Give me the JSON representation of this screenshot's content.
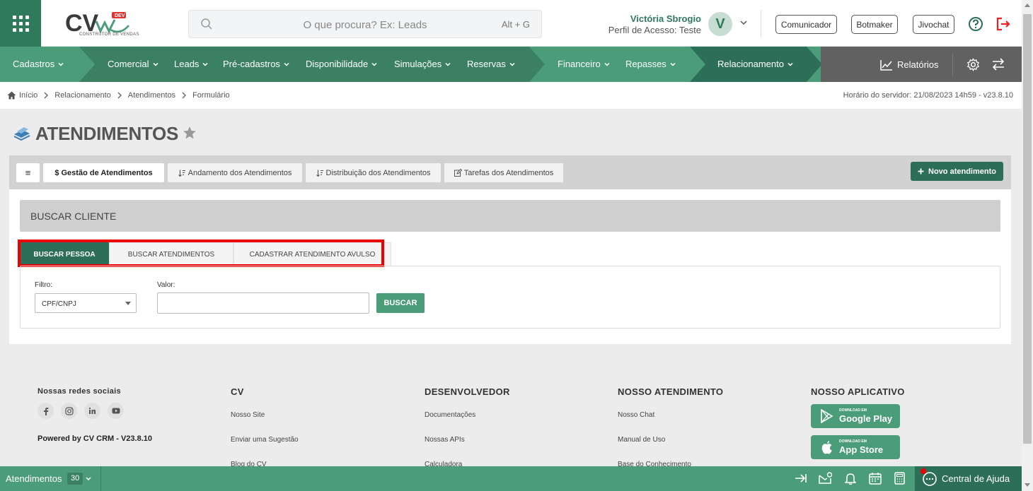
{
  "header": {
    "logo_text": "CV",
    "logo_badge": "DEV",
    "logo_sub": "CONSTRUTOR DE VENDAS",
    "search_placeholder": "O que procura? Ex: Leads",
    "search_shortcut": "Alt + G",
    "user_name": "Victória Sbrogio",
    "user_profile": "Perfil de Acesso: Teste",
    "avatar_letter": "V",
    "buttons": {
      "comunicador": "Comunicador",
      "botmaker": "Botmaker",
      "jivochat": "Jivochat"
    }
  },
  "nav": {
    "items": [
      "Cadastros",
      "Comercial",
      "Leads",
      "Pré-cadastros",
      "Disponibilidade",
      "Simulações",
      "Reservas",
      "Financeiro",
      "Repasses",
      "Relacionamento"
    ],
    "reports": "Relatórios"
  },
  "breadcrumb": {
    "items": [
      "Início",
      "Relacionamento",
      "Atendimentos",
      "Formulário"
    ],
    "server_time": "Horário do servidor: 21/08/2023 14h59 - v23.8.10"
  },
  "page": {
    "title": "ATENDIMENTOS"
  },
  "tabs": {
    "menu_glyph": "≡",
    "items": [
      "$ Gestão de Atendimentos",
      "Andamento dos Atendimentos",
      "Distribuição dos Atendimentos",
      "Tarefas dos Atendimentos"
    ],
    "new_button": "Novo atendimento"
  },
  "search_client": {
    "header": "BUSCAR CLIENTE",
    "subtabs": [
      "BUSCAR PESSOA",
      "BUSCAR ATENDIMENTOS",
      "CADASTRAR ATENDIMENTO AVULSO"
    ],
    "filter_label": "Filtro:",
    "filter_value": "CPF/CNPJ",
    "value_label": "Valor:",
    "value_input": "",
    "search_button": "BUSCAR"
  },
  "footer": {
    "social_title": "Nossas redes sociais",
    "powered": "Powered by CV CRM - V23.8.10",
    "columns": [
      {
        "title": "CV",
        "links": [
          "Nosso Site",
          "Enviar uma Sugestão",
          "Blog do CV"
        ]
      },
      {
        "title": "DESENVOLVEDOR",
        "links": [
          "Documentações",
          "Nossas APIs",
          "Calculadora"
        ]
      },
      {
        "title": "NOSSO ATENDIMENTO",
        "links": [
          "Nosso Chat",
          "Manual de Uso",
          "Base do Conhecimento"
        ]
      }
    ],
    "app_title": "NOSSO APLICATIVO",
    "google_small": "DOWNLOAD EM",
    "google_big": "Google Play",
    "apple_small": "DOWNLOAD EM",
    "apple_big": "App Store"
  },
  "bottom_bar": {
    "label": "Atendimentos",
    "count": "30",
    "help_center": "Central de Ajuda"
  },
  "colors": {
    "primary": "#4b9c78",
    "dark": "#2d6e59",
    "highlight": "#e00000"
  }
}
